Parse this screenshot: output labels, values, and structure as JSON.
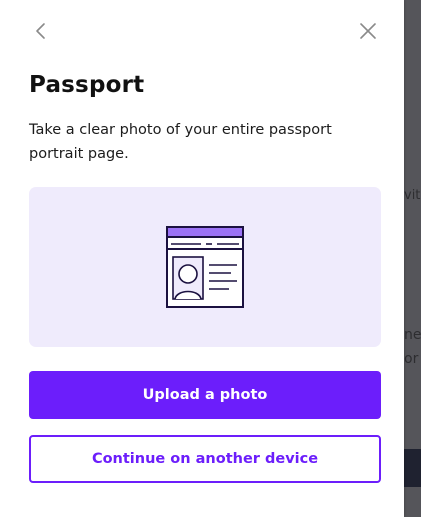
{
  "background": {
    "text_with": "vith",
    "text_ne": "ne",
    "text_or": "or"
  },
  "modal": {
    "title": "Passport",
    "description": "Take a clear photo of your entire passport portrait page.",
    "back_icon": "chevron-left-icon",
    "close_icon": "close-icon",
    "illustration_icon": "passport-icon"
  },
  "actions": {
    "primary_label": "Upload a photo",
    "secondary_label": "Continue on another device"
  },
  "colors": {
    "accent": "#6c1efb",
    "illustration_bg": "#efebfc",
    "illustration_accent": "#9b72f5",
    "icon_gray": "#8a8a8a"
  }
}
